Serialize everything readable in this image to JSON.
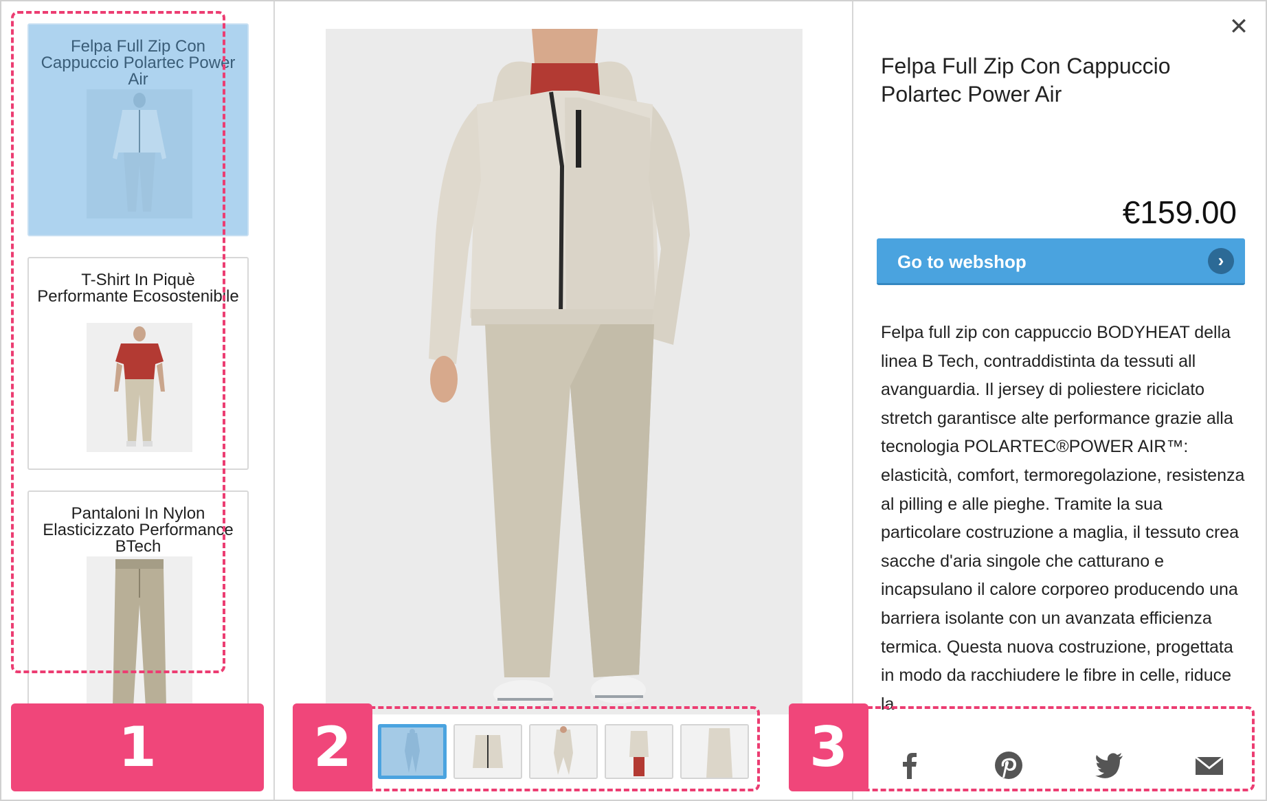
{
  "sidebar": {
    "items": [
      {
        "title": "Felpa Full Zip Con Cappuccio Polartec Power Air",
        "active": true
      },
      {
        "title": "T-Shirt In Piquè Performante Ecosostenibile",
        "active": false
      },
      {
        "title": "Pantaloni In Nylon Elasticizzato Performance BTech",
        "active": false
      }
    ]
  },
  "gallery": {
    "thumbnail_count": 5,
    "selected_index": 0
  },
  "product": {
    "title": "Felpa Full Zip Con Cappuccio Polartec Power Air",
    "price": "€159.00",
    "cta_label": "Go to webshop",
    "description": "Felpa full zip con cappuccio BODYHEAT della linea B Tech, contraddistinta da tessuti all avanguardia. Il jersey di poliestere riciclato stretch garantisce alte performance grazie alla tecnologia POLARTEC®POWER AIR™: elasticità, comfort, termoregolazione, resistenza al pilling e alle pieghe. Tramite la sua particolare costruzione a maglia, il tessuto crea sacche d'aria singole che catturano e incapsulano il calore corporeo producendo una barriera isolante con un avanzata efficienza termica. Questa nuova costruzione, progettata in modo da racchiudere le fibre in celle, riduce la"
  },
  "share": {
    "icons": [
      "facebook-icon",
      "pinterest-icon",
      "twitter-icon",
      "email-icon"
    ]
  },
  "callouts": {
    "one": "1",
    "two": "2",
    "three": "3"
  },
  "colors": {
    "accent": "#4aa3df",
    "callout": "#f0467a",
    "active_card": "#aed3ef"
  }
}
